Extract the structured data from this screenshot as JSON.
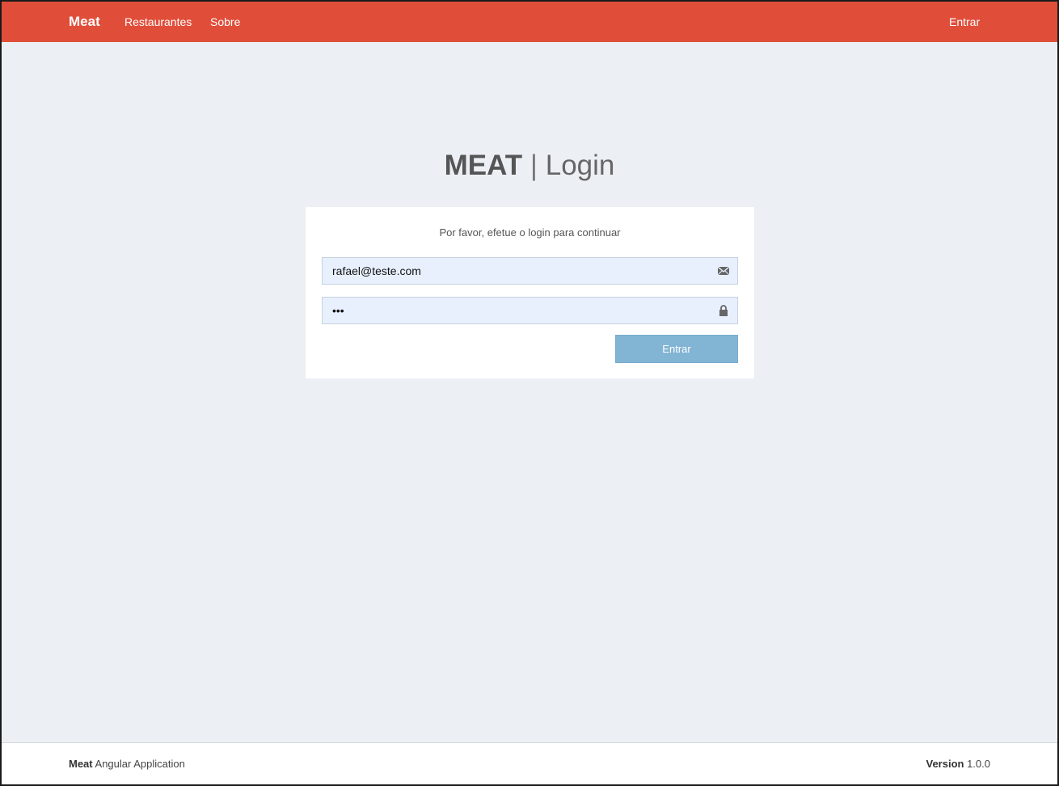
{
  "navbar": {
    "brand": "Meat",
    "links": [
      "Restaurantes",
      "Sobre"
    ],
    "login_link": "Entrar",
    "color": "#e04e3a"
  },
  "login": {
    "title_bold": "MEAT",
    "title_separator": "|",
    "title_light": "Login",
    "subtitle": "Por favor, efetue o login para continuar",
    "email_value": "rafael@teste.com",
    "email_icon": "envelope-icon",
    "password_value": "abc",
    "password_icon": "lock-icon",
    "submit_label": "Entrar",
    "button_color": "#82b4d4"
  },
  "footer": {
    "app_name": "Meat",
    "app_desc": "Angular Application",
    "version_label": "Version",
    "version_value": "1.0.0"
  }
}
